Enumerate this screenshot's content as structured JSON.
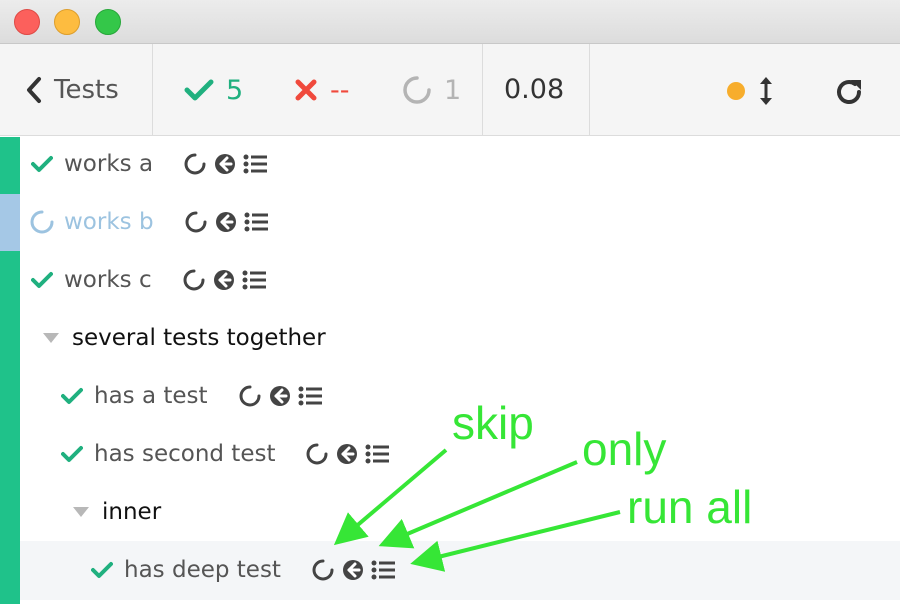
{
  "window": {
    "controls": [
      "close",
      "minimize",
      "zoom"
    ]
  },
  "toolbar": {
    "back_label": "Tests",
    "passed_count": "5",
    "failed_count": "--",
    "pending_count": "1",
    "duration": "0.08",
    "status_dot_color": "#f7ad2c"
  },
  "tests": [
    {
      "title": "works a",
      "status": "passed"
    },
    {
      "title": "works b",
      "status": "running"
    },
    {
      "title": "works c",
      "status": "passed"
    },
    {
      "title": "several tests together",
      "type": "suite"
    },
    {
      "title": "has a test",
      "status": "passed"
    },
    {
      "title": "has second test",
      "status": "passed"
    },
    {
      "title": "inner",
      "type": "suite"
    },
    {
      "title": "has deep test",
      "status": "passed"
    }
  ],
  "annotations": {
    "skip": "skip",
    "only": "only",
    "run_all": "run all",
    "color": "#36e636"
  },
  "colors": {
    "passed": "#20b07f",
    "failed": "#f0493c",
    "pending": "#b4b4b4",
    "running": "#9cc3e0"
  }
}
